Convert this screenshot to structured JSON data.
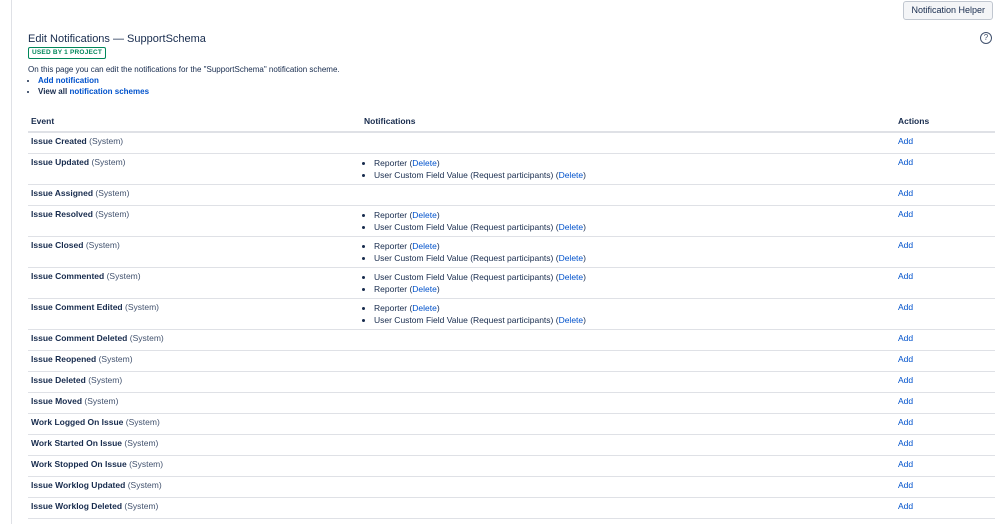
{
  "toolbar": {
    "notification_helper": "Notification Helper"
  },
  "page": {
    "title": "Edit Notifications — SupportSchema",
    "badge": "USED BY 1 PROJECT",
    "intro": "On this page you can edit the notifications for the \"SupportSchema\" notification scheme.",
    "add_notification": "Add notification",
    "view_all_prefix": "View all ",
    "notification_schemes": "notification schemes",
    "help_icon": "?"
  },
  "table": {
    "headers": {
      "event": "Event",
      "notifications": "Notifications",
      "actions": "Actions"
    },
    "system_label": "(System)",
    "add_label": "Add",
    "delete_label": "Delete",
    "rows": [
      {
        "event": "Issue Created",
        "notifications": []
      },
      {
        "event": "Issue Updated",
        "notifications": [
          "Reporter",
          "User Custom Field Value (Request participants)"
        ]
      },
      {
        "event": "Issue Assigned",
        "notifications": []
      },
      {
        "event": "Issue Resolved",
        "notifications": [
          "Reporter",
          "User Custom Field Value (Request participants)"
        ]
      },
      {
        "event": "Issue Closed",
        "notifications": [
          "Reporter",
          "User Custom Field Value (Request participants)"
        ]
      },
      {
        "event": "Issue Commented",
        "notifications": [
          "User Custom Field Value (Request participants)",
          "Reporter"
        ]
      },
      {
        "event": "Issue Comment Edited",
        "notifications": [
          "Reporter",
          "User Custom Field Value (Request participants)"
        ]
      },
      {
        "event": "Issue Comment Deleted",
        "notifications": []
      },
      {
        "event": "Issue Reopened",
        "notifications": []
      },
      {
        "event": "Issue Deleted",
        "notifications": []
      },
      {
        "event": "Issue Moved",
        "notifications": []
      },
      {
        "event": "Work Logged On Issue",
        "notifications": []
      },
      {
        "event": "Work Started On Issue",
        "notifications": []
      },
      {
        "event": "Work Stopped On Issue",
        "notifications": []
      },
      {
        "event": "Issue Worklog Updated",
        "notifications": []
      },
      {
        "event": "Issue Worklog Deleted",
        "notifications": []
      }
    ]
  }
}
